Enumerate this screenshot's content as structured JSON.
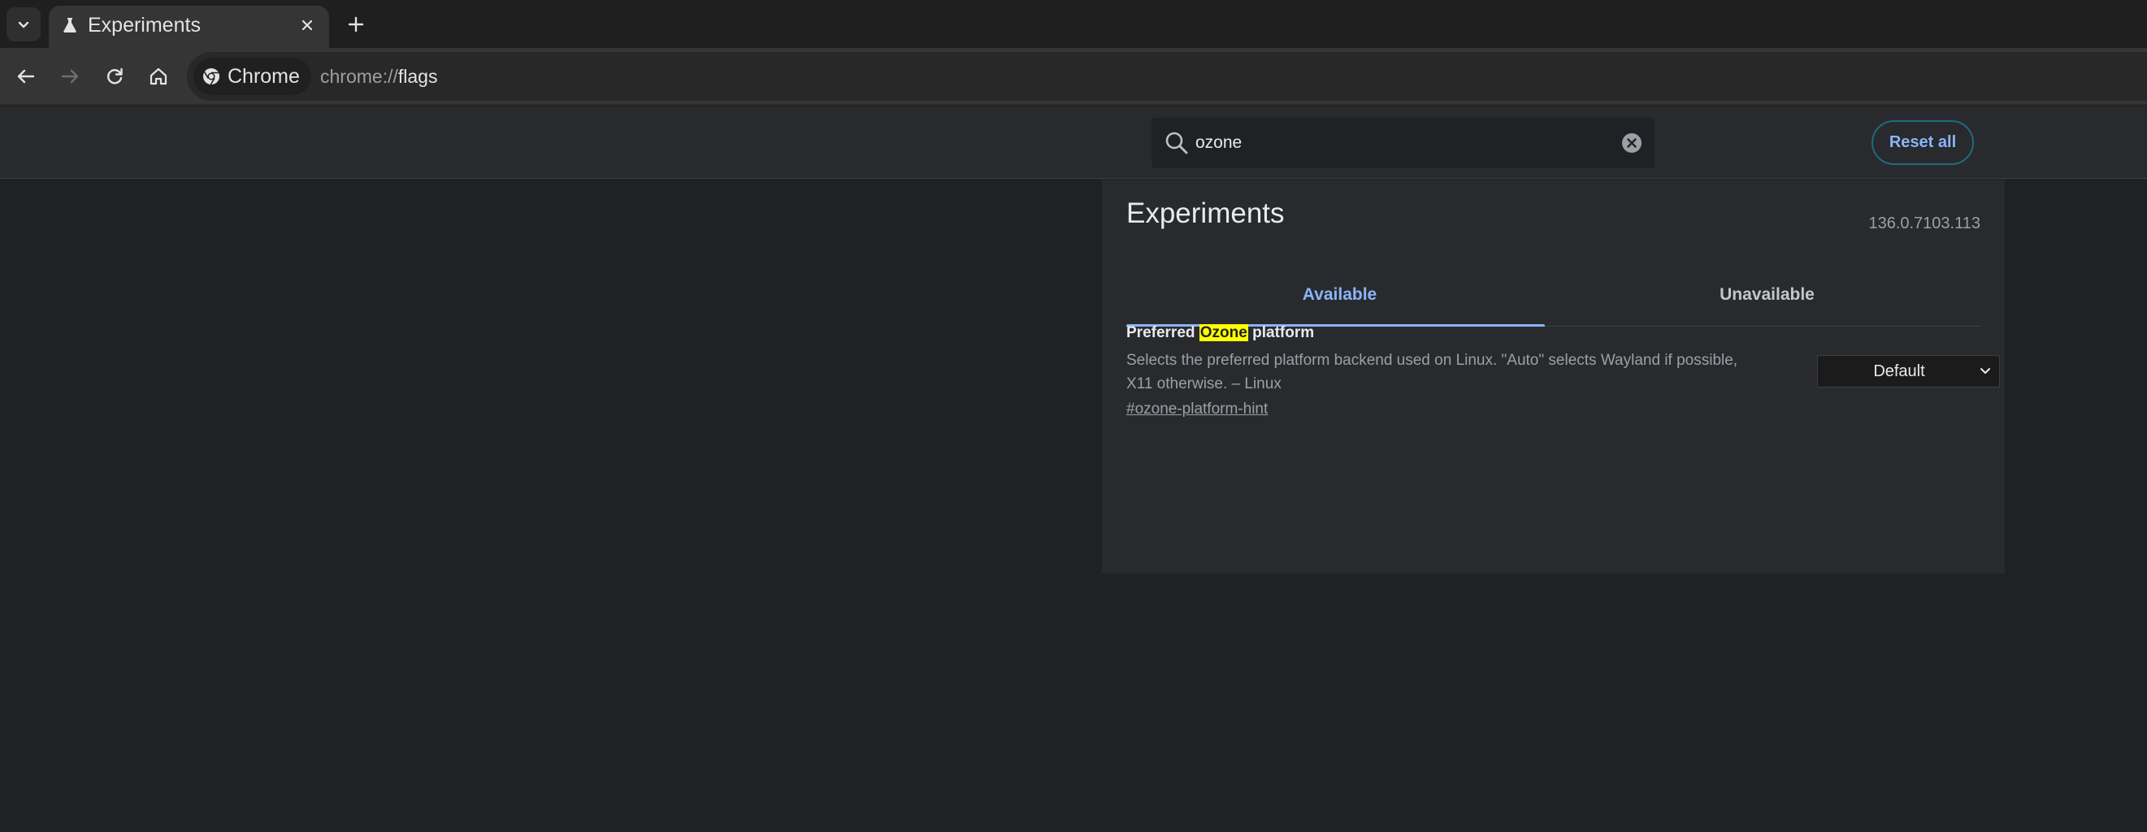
{
  "browser": {
    "tab_title": "Experiments",
    "chip_label": "Chrome",
    "url_scheme": "chrome://",
    "url_host": "flags"
  },
  "header": {
    "search_value": "ozone",
    "reset_label": "Reset all"
  },
  "main": {
    "title": "Experiments",
    "version": "136.0.7103.113",
    "tabs": [
      {
        "label": "Available",
        "selected": true
      },
      {
        "label": "Unavailable",
        "selected": false
      }
    ],
    "flags": [
      {
        "name_before": "Preferred ",
        "name_highlight": "Ozone",
        "name_after": " platform",
        "description": "Selects the preferred platform backend used on Linux. \"Auto\" selects Wayland if possible, X11 otherwise. – Linux",
        "link": "#ozone-platform-hint",
        "selected_option": "Default"
      }
    ]
  },
  "colors": {
    "accent": "#8ab4f8",
    "highlight": "#ffff00",
    "background": "#202124",
    "panel": "#292a2d"
  },
  "icons": [
    "chevron-down-icon",
    "flask-icon",
    "close-icon",
    "plus-icon",
    "back-icon",
    "forward-icon",
    "reload-icon",
    "home-icon",
    "chrome-logo-icon",
    "search-icon",
    "clear-icon"
  ]
}
